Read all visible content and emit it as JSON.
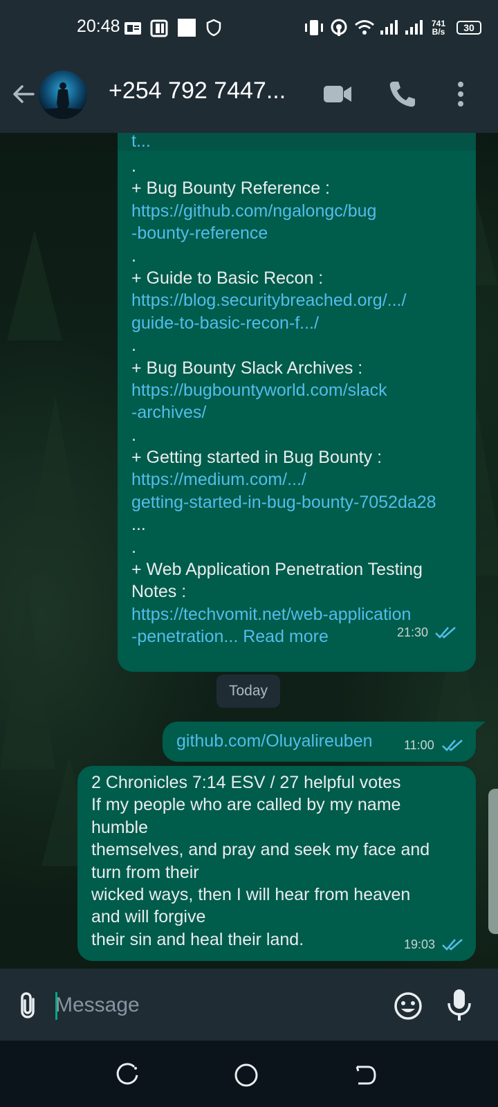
{
  "status_bar": {
    "time": "20:48",
    "net_speed_value": "741",
    "net_speed_unit": "B/s",
    "battery": "30"
  },
  "header": {
    "contact_name": "+254 792 7447...",
    "icons": [
      "back-arrow-icon",
      "video-call-icon",
      "voice-call-icon",
      "more-options-icon"
    ]
  },
  "messages": {
    "first": {
      "truncated_top": "t...",
      "lines": [
        {
          "text": ".",
          "type": "text"
        },
        {
          "text": "+ Bug Bounty Reference :",
          "type": "text"
        },
        {
          "text": "https://github.com/ngalongc/bug",
          "type": "link"
        },
        {
          "text": "-bounty-reference",
          "type": "link"
        },
        {
          "text": ".",
          "type": "text"
        },
        {
          "text": "+ Guide to Basic Recon :",
          "type": "text"
        },
        {
          "text": "https://blog.securitybreached.org/.../",
          "type": "link"
        },
        {
          "text": "guide-to-basic-recon-f.../",
          "type": "link"
        },
        {
          "text": ".",
          "type": "text"
        },
        {
          "text": "+ Bug Bounty Slack Archives :",
          "type": "text"
        },
        {
          "text": "https://bugbountyworld.com/slack",
          "type": "link"
        },
        {
          "text": "-archives/",
          "type": "link"
        },
        {
          "text": ".",
          "type": "text"
        },
        {
          "text": "+ Getting started in Bug Bounty :",
          "type": "text"
        },
        {
          "text": "https://medium.com/.../",
          "type": "link"
        },
        {
          "text": "getting-started-in-bug-bounty-7052da28",
          "type": "link"
        },
        {
          "text": "...",
          "type": "text"
        },
        {
          "text": ".",
          "type": "text"
        },
        {
          "text": "+ Web Application Penetration Testing",
          "type": "text"
        },
        {
          "text": "Notes :",
          "type": "text"
        },
        {
          "text": "https://techvomit.net/web-application",
          "type": "link"
        }
      ],
      "last_line_link": "-penetration...",
      "read_more": "Read more",
      "time": "21:30"
    },
    "date_divider": "Today",
    "second": {
      "text": "github.com/Oluyalireuben",
      "time": "11:00"
    },
    "third": {
      "lines": [
        "2 Chronicles 7:14 ESV / 27 helpful votes",
        "If my people who are called by my name",
        "humble",
        "themselves, and pray and seek my face and",
        "turn from their",
        "wicked ways, then I will hear from heaven",
        "and will forgive",
        "their sin and heal their land."
      ],
      "time": "19:03"
    }
  },
  "input": {
    "placeholder": "Message"
  },
  "colors": {
    "bubble_out": "#005c4b",
    "link": "#53bdeb",
    "read_ticks": "#53bdeb",
    "bar_bg": "#1f2c34",
    "accent": "#00a884"
  }
}
